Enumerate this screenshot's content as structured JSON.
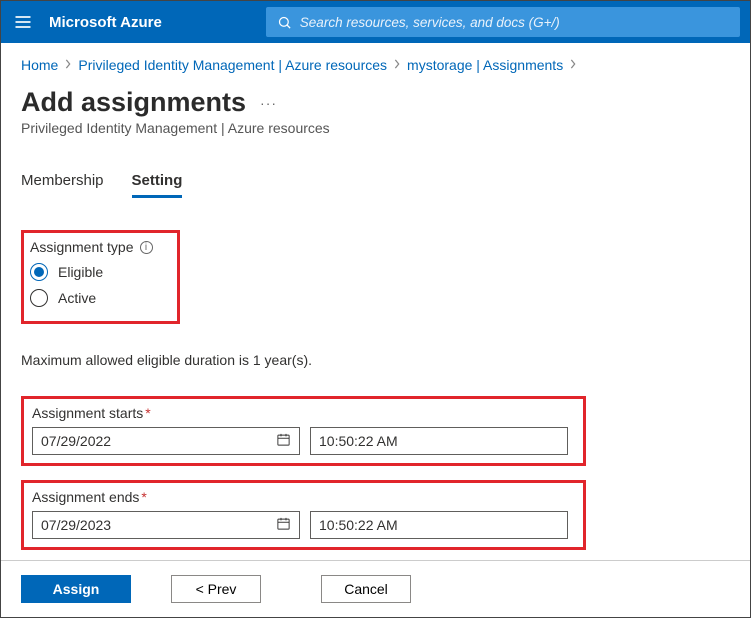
{
  "header": {
    "brand": "Microsoft Azure",
    "search_placeholder": "Search resources, services, and docs (G+/)"
  },
  "breadcrumb": {
    "items": [
      {
        "label": "Home"
      },
      {
        "label": "Privileged Identity Management | Azure resources"
      },
      {
        "label": "mystorage | Assignments"
      }
    ]
  },
  "page": {
    "title": "Add assignments",
    "subtitle": "Privileged Identity Management | Azure resources",
    "more": "···"
  },
  "tabs": {
    "membership": "Membership",
    "setting": "Setting"
  },
  "form": {
    "assignment_type_label": "Assignment type",
    "radio_eligible": "Eligible",
    "radio_active": "Active",
    "max_note": "Maximum allowed eligible duration is 1 year(s).",
    "starts_label": "Assignment starts",
    "starts_date": "07/29/2022",
    "starts_time": "10:50:22 AM",
    "ends_label": "Assignment ends",
    "ends_date": "07/29/2023",
    "ends_time": "10:50:22 AM"
  },
  "footer": {
    "assign": "Assign",
    "prev": "<  Prev",
    "cancel": "Cancel"
  }
}
